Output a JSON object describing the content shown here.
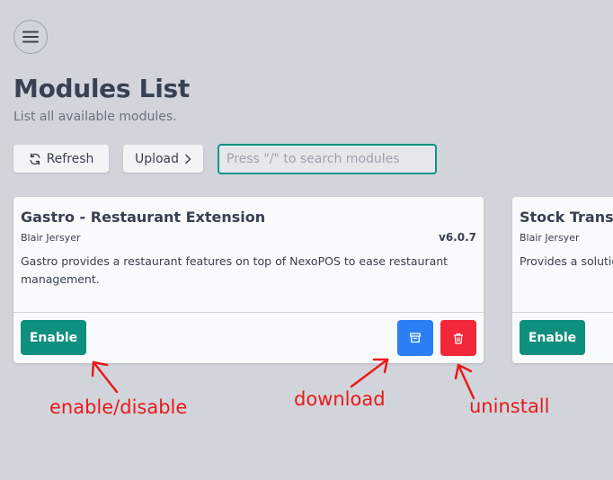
{
  "header": {
    "menu_icon": "hamburger-menu-icon",
    "title": "Modules List",
    "subtitle": "List all available modules."
  },
  "toolbar": {
    "refresh_label": "Refresh",
    "refresh_icon": "refresh-icon",
    "upload_label": "Upload",
    "upload_icon": "chevron-right-icon",
    "search_placeholder": "Press \"/\" to search modules"
  },
  "modules": [
    {
      "name": "Gastro - Restaurant Extension",
      "author": "Blair Jersyer",
      "version": "v6.0.7",
      "description": "Gastro provides a restaurant features on top of NexoPOS to ease restaurant management.",
      "enable_label": "Enable",
      "download_icon": "archive-download-icon",
      "delete_icon": "trash-icon"
    },
    {
      "name": "Stock Transfe",
      "author": "Blair Jersyer",
      "description": "Provides a solutio",
      "enable_label": "Enable"
    }
  ],
  "annotations": {
    "enable": "enable/disable",
    "download": "download",
    "uninstall": "uninstall",
    "color": "#e81a1a"
  },
  "colors": {
    "background": "#d1d5db",
    "enable": "#0f8f7e",
    "download": "#2b7ef3",
    "delete": "#f0283a",
    "search_border": "#0d9488"
  }
}
